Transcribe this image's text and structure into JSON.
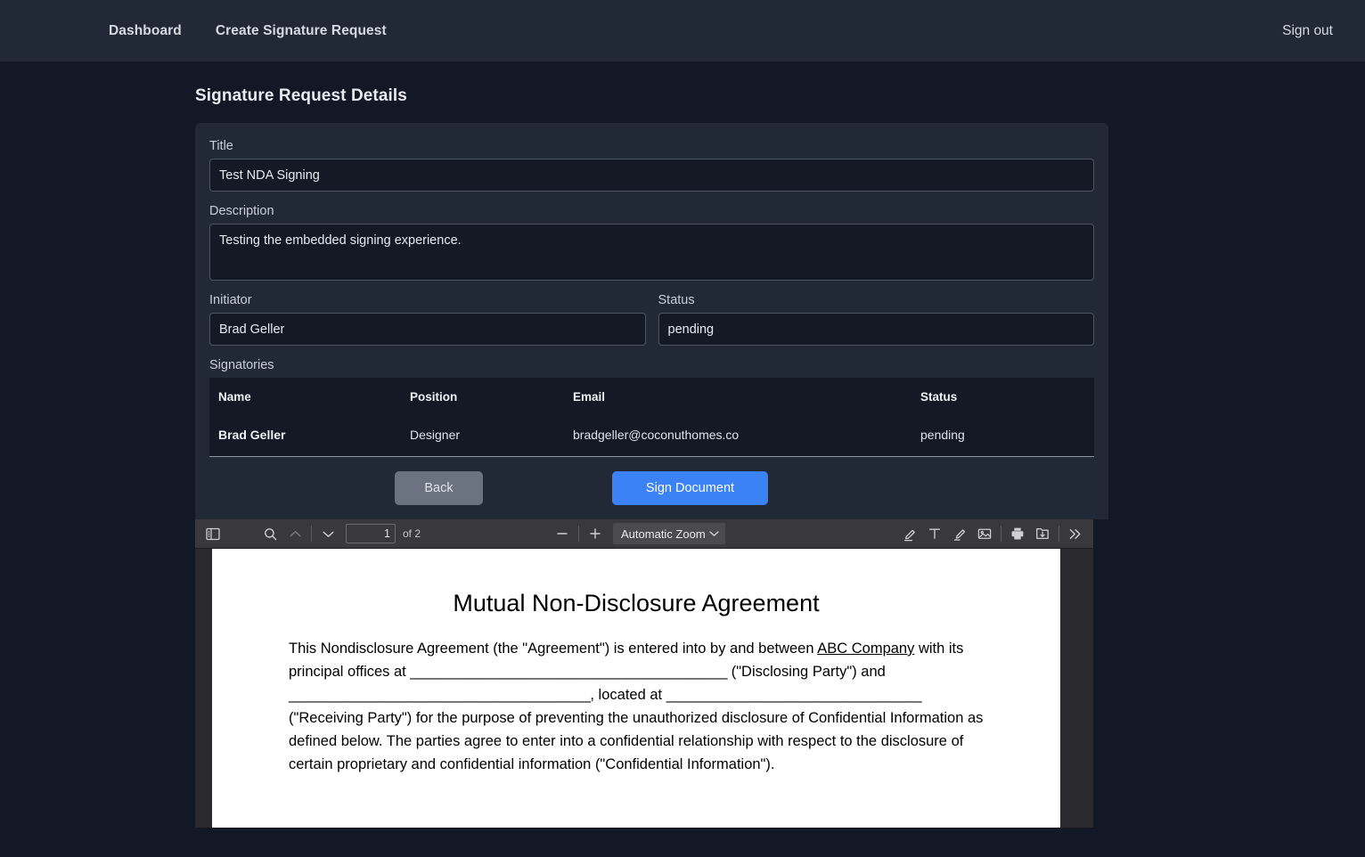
{
  "navbar": {
    "links": [
      {
        "label": "Dashboard"
      },
      {
        "label": "Create Signature Request"
      }
    ],
    "signout_label": "Sign out"
  },
  "page": {
    "title": "Signature Request Details"
  },
  "form": {
    "title_label": "Title",
    "title_value": "Test NDA Signing",
    "description_label": "Description",
    "description_value": "Testing the embedded signing experience.",
    "initiator_label": "Initiator",
    "initiator_value": "Brad Geller",
    "status_label": "Status",
    "status_value": "pending"
  },
  "signatories": {
    "label": "Signatories",
    "columns": [
      "Name",
      "Position",
      "Email",
      "Status"
    ],
    "rows": [
      {
        "name": "Brad Geller",
        "position": "Designer",
        "email": "bradgeller@coconuthomes.co",
        "status": "pending"
      }
    ]
  },
  "actions": {
    "back_label": "Back",
    "sign_label": "Sign Document",
    "sign_color": "#3b82f6",
    "back_color": "#6b7280"
  },
  "pdf_toolbar": {
    "sidebar_toggle": "sidebar-toggle-icon",
    "find": "search-icon",
    "previous_page": "chevron-up-icon",
    "next_page": "chevron-down-icon",
    "page_number": "1",
    "page_count_label": "of 2",
    "zoom_out": "minus-icon",
    "zoom_in": "plus-icon",
    "zoom_level": "Automatic Zoom",
    "zoom_options": [
      "Automatic Zoom"
    ],
    "tools": [
      "highlighter-icon",
      "text-icon",
      "draw-icon",
      "image-icon",
      "print-icon",
      "save-icon",
      "more-tools-icon"
    ]
  },
  "document": {
    "title": "Mutual Non-Disclosure Agreement",
    "para_lines": [
      "This Nondisclosure Agreement (the \"Agreement\") is entered into by and between ",
      "ABC Company",
      " with its principal offices at ",
      "_________________________________________",
      " (\"Disclosing Party\") and ",
      "_______________________________________",
      ", located at ",
      "_________________________________",
      " (\"Receiving Party\") for the purpose of preventing the unauthorized disclosure of Confidential Information as defined below. The parties agree to enter into a confidential relationship with respect to the disclosure of certain proprietary and confidential information (\"Confidential Information\")."
    ]
  }
}
